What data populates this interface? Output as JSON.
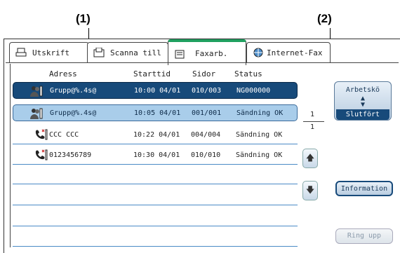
{
  "callouts": {
    "one": "(1)",
    "two": "(2)"
  },
  "tabs": [
    {
      "label": "Utskrift"
    },
    {
      "label": "Scanna till"
    },
    {
      "label": "Faxarb."
    },
    {
      "label": "Internet-Fax"
    }
  ],
  "columns": {
    "address": "Adress",
    "start": "Starttid",
    "pages": "Sidor",
    "status": "Status"
  },
  "jobs": [
    {
      "address": "Grupp@%.4s@",
      "start": "10:00 04/01",
      "pages": "010/003",
      "status": "NG000000",
      "icon": "group-icon"
    },
    {
      "address": "Grupp@%.4s@",
      "start": "10:05 04/01",
      "pages": "001/001",
      "status": "Sändning OK",
      "icon": "group-icon"
    },
    {
      "address": "CCC CCC",
      "start": "10:22 04/01",
      "pages": "004/004",
      "status": "Sändning OK",
      "icon": "phone-icon"
    },
    {
      "address": "0123456789",
      "start": "10:30 04/01",
      "pages": "010/010",
      "status": "Sändning OK",
      "icon": "phone-icon"
    }
  ],
  "side": {
    "queue_top": "Arbetskö",
    "queue_bottom": "Slutfört",
    "page_current": "1",
    "page_total": "1",
    "info": "Information",
    "call": "Ring upp"
  }
}
